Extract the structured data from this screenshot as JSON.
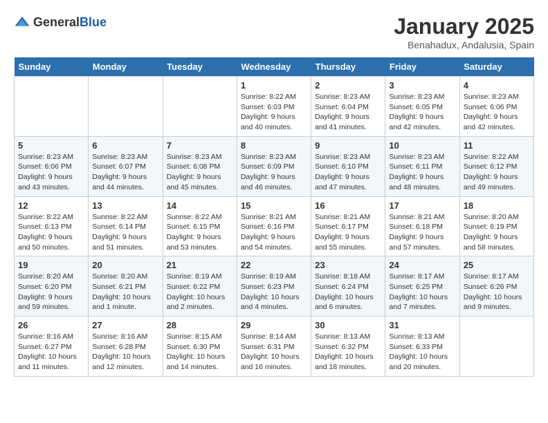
{
  "logo": {
    "general": "General",
    "blue": "Blue"
  },
  "title": "January 2025",
  "subtitle": "Benahadux, Andalusia, Spain",
  "days_of_week": [
    "Sunday",
    "Monday",
    "Tuesday",
    "Wednesday",
    "Thursday",
    "Friday",
    "Saturday"
  ],
  "weeks": [
    [
      {
        "day": "",
        "info": ""
      },
      {
        "day": "",
        "info": ""
      },
      {
        "day": "",
        "info": ""
      },
      {
        "day": "1",
        "info": "Sunrise: 8:22 AM\nSunset: 6:03 PM\nDaylight: 9 hours\nand 40 minutes."
      },
      {
        "day": "2",
        "info": "Sunrise: 8:23 AM\nSunset: 6:04 PM\nDaylight: 9 hours\nand 41 minutes."
      },
      {
        "day": "3",
        "info": "Sunrise: 8:23 AM\nSunset: 6:05 PM\nDaylight: 9 hours\nand 42 minutes."
      },
      {
        "day": "4",
        "info": "Sunrise: 8:23 AM\nSunset: 6:06 PM\nDaylight: 9 hours\nand 42 minutes."
      }
    ],
    [
      {
        "day": "5",
        "info": "Sunrise: 8:23 AM\nSunset: 6:06 PM\nDaylight: 9 hours\nand 43 minutes."
      },
      {
        "day": "6",
        "info": "Sunrise: 8:23 AM\nSunset: 6:07 PM\nDaylight: 9 hours\nand 44 minutes."
      },
      {
        "day": "7",
        "info": "Sunrise: 8:23 AM\nSunset: 6:08 PM\nDaylight: 9 hours\nand 45 minutes."
      },
      {
        "day": "8",
        "info": "Sunrise: 8:23 AM\nSunset: 6:09 PM\nDaylight: 9 hours\nand 46 minutes."
      },
      {
        "day": "9",
        "info": "Sunrise: 8:23 AM\nSunset: 6:10 PM\nDaylight: 9 hours\nand 47 minutes."
      },
      {
        "day": "10",
        "info": "Sunrise: 8:23 AM\nSunset: 6:11 PM\nDaylight: 9 hours\nand 48 minutes."
      },
      {
        "day": "11",
        "info": "Sunrise: 8:22 AM\nSunset: 6:12 PM\nDaylight: 9 hours\nand 49 minutes."
      }
    ],
    [
      {
        "day": "12",
        "info": "Sunrise: 8:22 AM\nSunset: 6:13 PM\nDaylight: 9 hours\nand 50 minutes."
      },
      {
        "day": "13",
        "info": "Sunrise: 8:22 AM\nSunset: 6:14 PM\nDaylight: 9 hours\nand 51 minutes."
      },
      {
        "day": "14",
        "info": "Sunrise: 8:22 AM\nSunset: 6:15 PM\nDaylight: 9 hours\nand 53 minutes."
      },
      {
        "day": "15",
        "info": "Sunrise: 8:21 AM\nSunset: 6:16 PM\nDaylight: 9 hours\nand 54 minutes."
      },
      {
        "day": "16",
        "info": "Sunrise: 8:21 AM\nSunset: 6:17 PM\nDaylight: 9 hours\nand 55 minutes."
      },
      {
        "day": "17",
        "info": "Sunrise: 8:21 AM\nSunset: 6:18 PM\nDaylight: 9 hours\nand 57 minutes."
      },
      {
        "day": "18",
        "info": "Sunrise: 8:20 AM\nSunset: 6:19 PM\nDaylight: 9 hours\nand 58 minutes."
      }
    ],
    [
      {
        "day": "19",
        "info": "Sunrise: 8:20 AM\nSunset: 6:20 PM\nDaylight: 9 hours\nand 59 minutes."
      },
      {
        "day": "20",
        "info": "Sunrise: 8:20 AM\nSunset: 6:21 PM\nDaylight: 10 hours\nand 1 minute."
      },
      {
        "day": "21",
        "info": "Sunrise: 8:19 AM\nSunset: 6:22 PM\nDaylight: 10 hours\nand 2 minutes."
      },
      {
        "day": "22",
        "info": "Sunrise: 8:19 AM\nSunset: 6:23 PM\nDaylight: 10 hours\nand 4 minutes."
      },
      {
        "day": "23",
        "info": "Sunrise: 8:18 AM\nSunset: 6:24 PM\nDaylight: 10 hours\nand 6 minutes."
      },
      {
        "day": "24",
        "info": "Sunrise: 8:17 AM\nSunset: 6:25 PM\nDaylight: 10 hours\nand 7 minutes."
      },
      {
        "day": "25",
        "info": "Sunrise: 8:17 AM\nSunset: 6:26 PM\nDaylight: 10 hours\nand 9 minutes."
      }
    ],
    [
      {
        "day": "26",
        "info": "Sunrise: 8:16 AM\nSunset: 6:27 PM\nDaylight: 10 hours\nand 11 minutes."
      },
      {
        "day": "27",
        "info": "Sunrise: 8:16 AM\nSunset: 6:28 PM\nDaylight: 10 hours\nand 12 minutes."
      },
      {
        "day": "28",
        "info": "Sunrise: 8:15 AM\nSunset: 6:30 PM\nDaylight: 10 hours\nand 14 minutes."
      },
      {
        "day": "29",
        "info": "Sunrise: 8:14 AM\nSunset: 6:31 PM\nDaylight: 10 hours\nand 16 minutes."
      },
      {
        "day": "30",
        "info": "Sunrise: 8:13 AM\nSunset: 6:32 PM\nDaylight: 10 hours\nand 18 minutes."
      },
      {
        "day": "31",
        "info": "Sunrise: 8:13 AM\nSunset: 6:33 PM\nDaylight: 10 hours\nand 20 minutes."
      },
      {
        "day": "",
        "info": ""
      }
    ]
  ]
}
